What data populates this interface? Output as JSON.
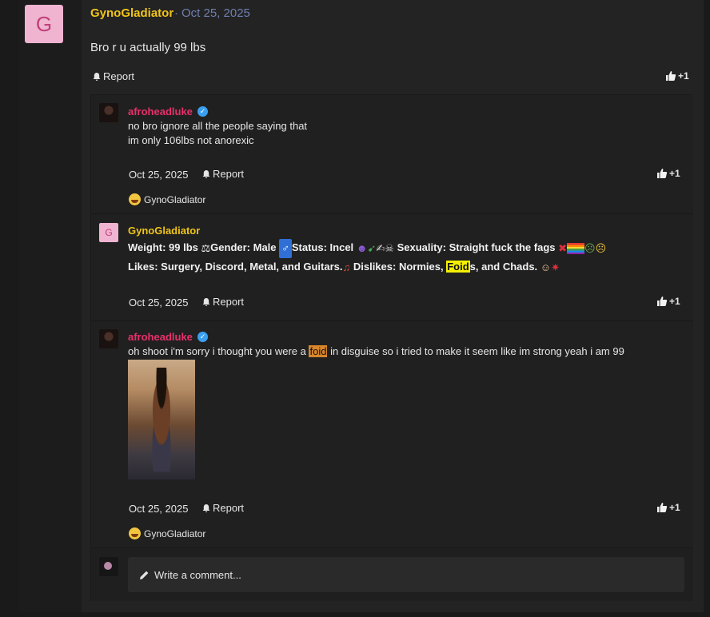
{
  "post": {
    "avatar_letter": "G",
    "author": "GynoGladiator",
    "separator": "·",
    "date": "Oct 25, 2025",
    "body": "Bro r u actually 99 lbs",
    "report_label": "Report",
    "like_count": "+1"
  },
  "replies": [
    {
      "author": "afroheadluke",
      "verified": true,
      "lines": [
        "no bro ignore all the people saying that",
        "im only 106lbs not anorexic"
      ],
      "date": "Oct 25, 2025",
      "report_label": "Report",
      "like_count": "+1",
      "reaction_user": "GynoGladiator"
    },
    {
      "author": "GynoGladiator",
      "avatar_letter": "G",
      "line1": {
        "weight": "Weight: 99 lbs ",
        "gender": "Gender: Male ",
        "status": "Status: Incel ",
        "sexuality": " Sexuality: Straight fuck the fags "
      },
      "line2": {
        "likes": "Likes: Surgery, Discord, Metal, and Guitars.",
        "dislikes_pre": " Dislikes: Normies, ",
        "highlight": "Foid",
        "dislikes_post": "s, and Chads. "
      },
      "date": "Oct 25, 2025",
      "report_label": "Report",
      "like_count": "+1"
    },
    {
      "author": "afroheadluke",
      "verified": true,
      "text_pre": "oh shoot i'm sorry i thought you were a ",
      "highlight": "foid",
      "text_post": " in disguise so i tried to make it seem like im strong yeah i am 99",
      "date": "Oct 25, 2025",
      "report_label": "Report",
      "like_count": "+1",
      "reaction_user": "GynoGladiator"
    }
  ],
  "comment": {
    "placeholder": "Write a comment..."
  },
  "colors": {
    "author_gold": "#f0c419",
    "author_pink": "#e8306b",
    "date_blue": "#6f7fb0",
    "verified_blue": "#3a9ff0"
  }
}
